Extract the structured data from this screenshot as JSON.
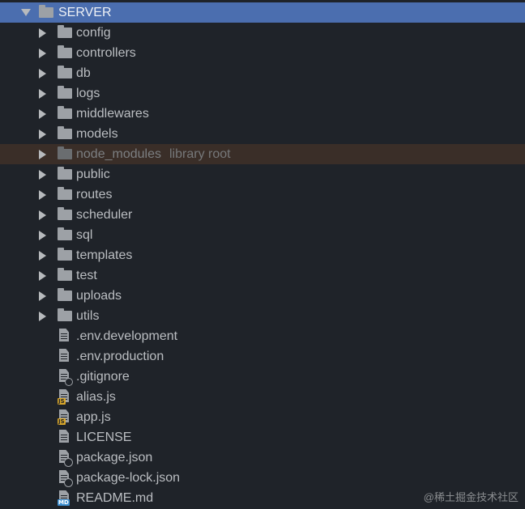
{
  "root": {
    "label": "SERVER",
    "icon": "folder-icon",
    "expanded": true
  },
  "folders": [
    {
      "label": "config"
    },
    {
      "label": "controllers"
    },
    {
      "label": "db"
    },
    {
      "label": "logs"
    },
    {
      "label": "middlewares"
    },
    {
      "label": "models"
    },
    {
      "label": "node_modules",
      "suffix": "library root",
      "excluded": true
    },
    {
      "label": "public"
    },
    {
      "label": "routes"
    },
    {
      "label": "scheduler"
    },
    {
      "label": "sql"
    },
    {
      "label": "templates"
    },
    {
      "label": "test"
    },
    {
      "label": "uploads"
    },
    {
      "label": "utils"
    }
  ],
  "files": [
    {
      "label": ".env.development",
      "icon": "text-file-icon"
    },
    {
      "label": ".env.production",
      "icon": "text-file-icon"
    },
    {
      "label": ".gitignore",
      "icon": "ignore-file-icon"
    },
    {
      "label": "alias.js",
      "icon": "js-file-icon",
      "badge": "JS"
    },
    {
      "label": "app.js",
      "icon": "js-file-icon",
      "badge": "JS"
    },
    {
      "label": "LICENSE",
      "icon": "text-file-icon"
    },
    {
      "label": "package.json",
      "icon": "config-file-icon"
    },
    {
      "label": "package-lock.json",
      "icon": "config-file-icon"
    },
    {
      "label": "README.md",
      "icon": "markdown-file-icon",
      "badge": "MD"
    }
  ],
  "watermark": "@稀土掘金技术社区",
  "colors": {
    "background": "#1f2329",
    "selected_row": "#4b6eaf",
    "excluded_row": "#3a2e28",
    "text": "#bbbec2",
    "js_badge": "#d9a72b",
    "md_badge": "#3d8fd1"
  }
}
